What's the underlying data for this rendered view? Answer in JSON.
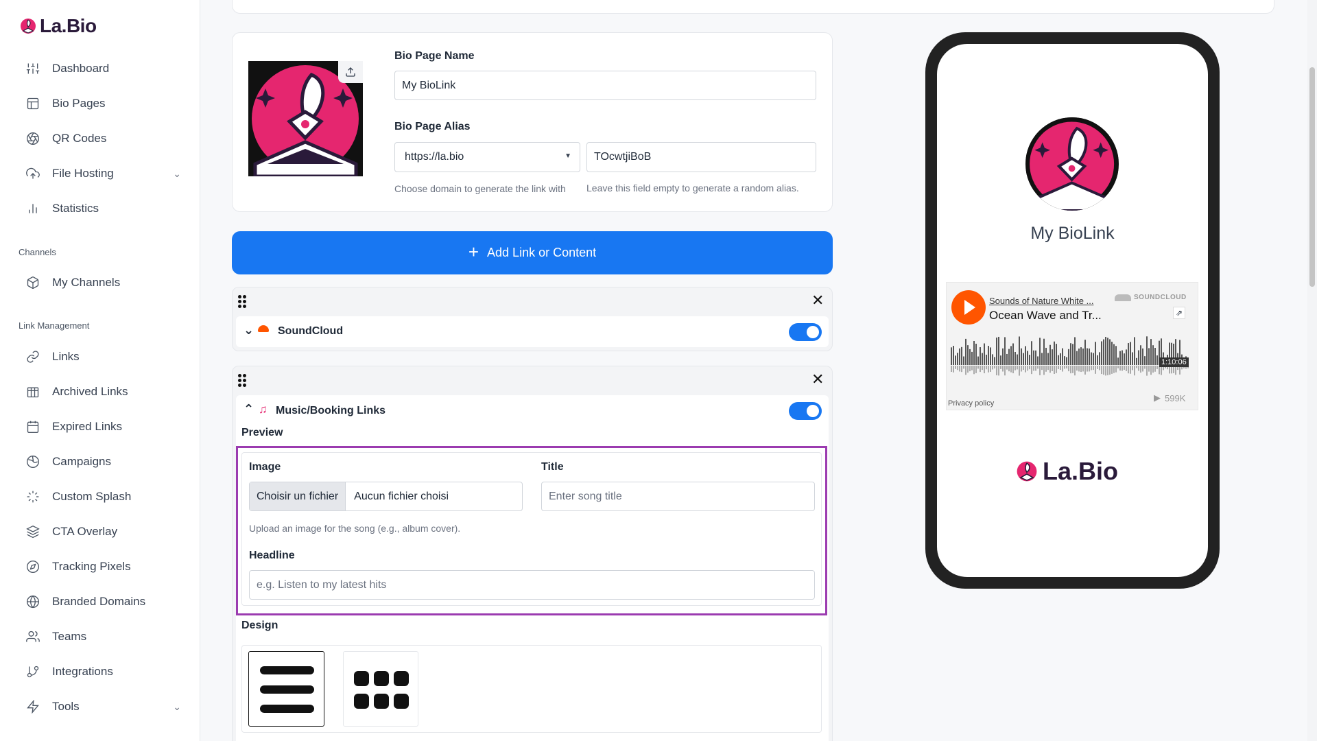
{
  "brand": {
    "name": "La.Bio",
    "accent": "#e5266f",
    "primary": "#1877f2"
  },
  "sidebar": {
    "items": [
      {
        "label": "Dashboard",
        "icon": "sliders-icon"
      },
      {
        "label": "Bio Pages",
        "icon": "layout-icon"
      },
      {
        "label": "QR Codes",
        "icon": "aperture-icon"
      },
      {
        "label": "File Hosting",
        "icon": "upload-cloud-icon"
      },
      {
        "label": "Statistics",
        "icon": "bar-chart-icon"
      }
    ],
    "channels_heading": "Channels",
    "channels": [
      {
        "label": "My Channels",
        "icon": "box-icon"
      }
    ],
    "link_management_heading": "Link Management",
    "link_items": [
      {
        "label": "Links",
        "icon": "link-icon"
      },
      {
        "label": "Archived Links",
        "icon": "archive-icon"
      },
      {
        "label": "Expired Links",
        "icon": "calendar-icon"
      },
      {
        "label": "Campaigns",
        "icon": "globe-icon"
      },
      {
        "label": "Custom Splash",
        "icon": "loader-icon"
      },
      {
        "label": "CTA Overlay",
        "icon": "layers-icon"
      },
      {
        "label": "Tracking Pixels",
        "icon": "compass-icon"
      },
      {
        "label": "Branded Domains",
        "icon": "globe-icon"
      },
      {
        "label": "Teams",
        "icon": "users-icon"
      },
      {
        "label": "Integrations",
        "icon": "git-branch-icon"
      },
      {
        "label": "Tools",
        "icon": "zap-icon"
      }
    ]
  },
  "bio": {
    "name_label": "Bio Page Name",
    "name_value": "My BioLink",
    "alias_label": "Bio Page Alias",
    "domain_value": "https://la.bio",
    "alias_value": "TOcwtjiBoB",
    "domain_help": "Choose domain to generate the link with",
    "alias_help": "Leave this field empty to generate a random alias."
  },
  "add_button": "Add Link or Content",
  "blocks": {
    "soundcloud_title": "SoundCloud",
    "music_title": "Music/Booking Links",
    "preview_heading": "Preview",
    "image_label": "Image",
    "file_choose": "Choisir un fichier",
    "file_none": "Aucun fichier choisi",
    "image_help": "Upload an image for the song (e.g., album cover).",
    "title_label": "Title",
    "title_placeholder": "Enter song title",
    "headline_label": "Headline",
    "headline_placeholder": "e.g. Listen to my latest hits",
    "design_heading": "Design"
  },
  "phone": {
    "profile_name": "My BioLink",
    "sc_artist": "Sounds of Nature White ...",
    "sc_track": "Ocean Wave and Tr...",
    "sc_brand": "SOUNDCLOUD",
    "sc_duration": "1:10:06",
    "sc_privacy": "Privacy policy",
    "sc_plays": "599K",
    "footer_logo": "La.Bio"
  }
}
